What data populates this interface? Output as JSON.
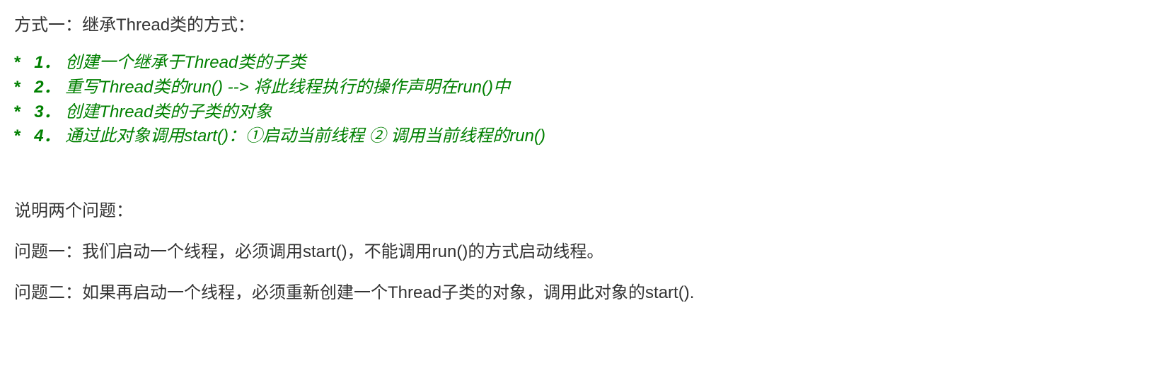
{
  "heading": "方式一：继承Thread类的方式：",
  "steps": [
    {
      "num": "1．",
      "text": "创建一个继承于Thread类的子类"
    },
    {
      "num": "2．",
      "text": "重写Thread类的run() --> 将此线程执行的操作声明在run()中"
    },
    {
      "num": "3．",
      "text": "创建Thread类的子类的对象"
    },
    {
      "num": "4．",
      "text": "通过此对象调用start()：①启动当前线程 ② 调用当前线程的run()"
    }
  ],
  "notes": {
    "title": "说明两个问题：",
    "q1": "问题一：我们启动一个线程，必须调用start()，不能调用run()的方式启动线程。",
    "q2": "问题二：如果再启动一个线程，必须重新创建一个Thread子类的对象，调用此对象的start()."
  },
  "star": "*"
}
